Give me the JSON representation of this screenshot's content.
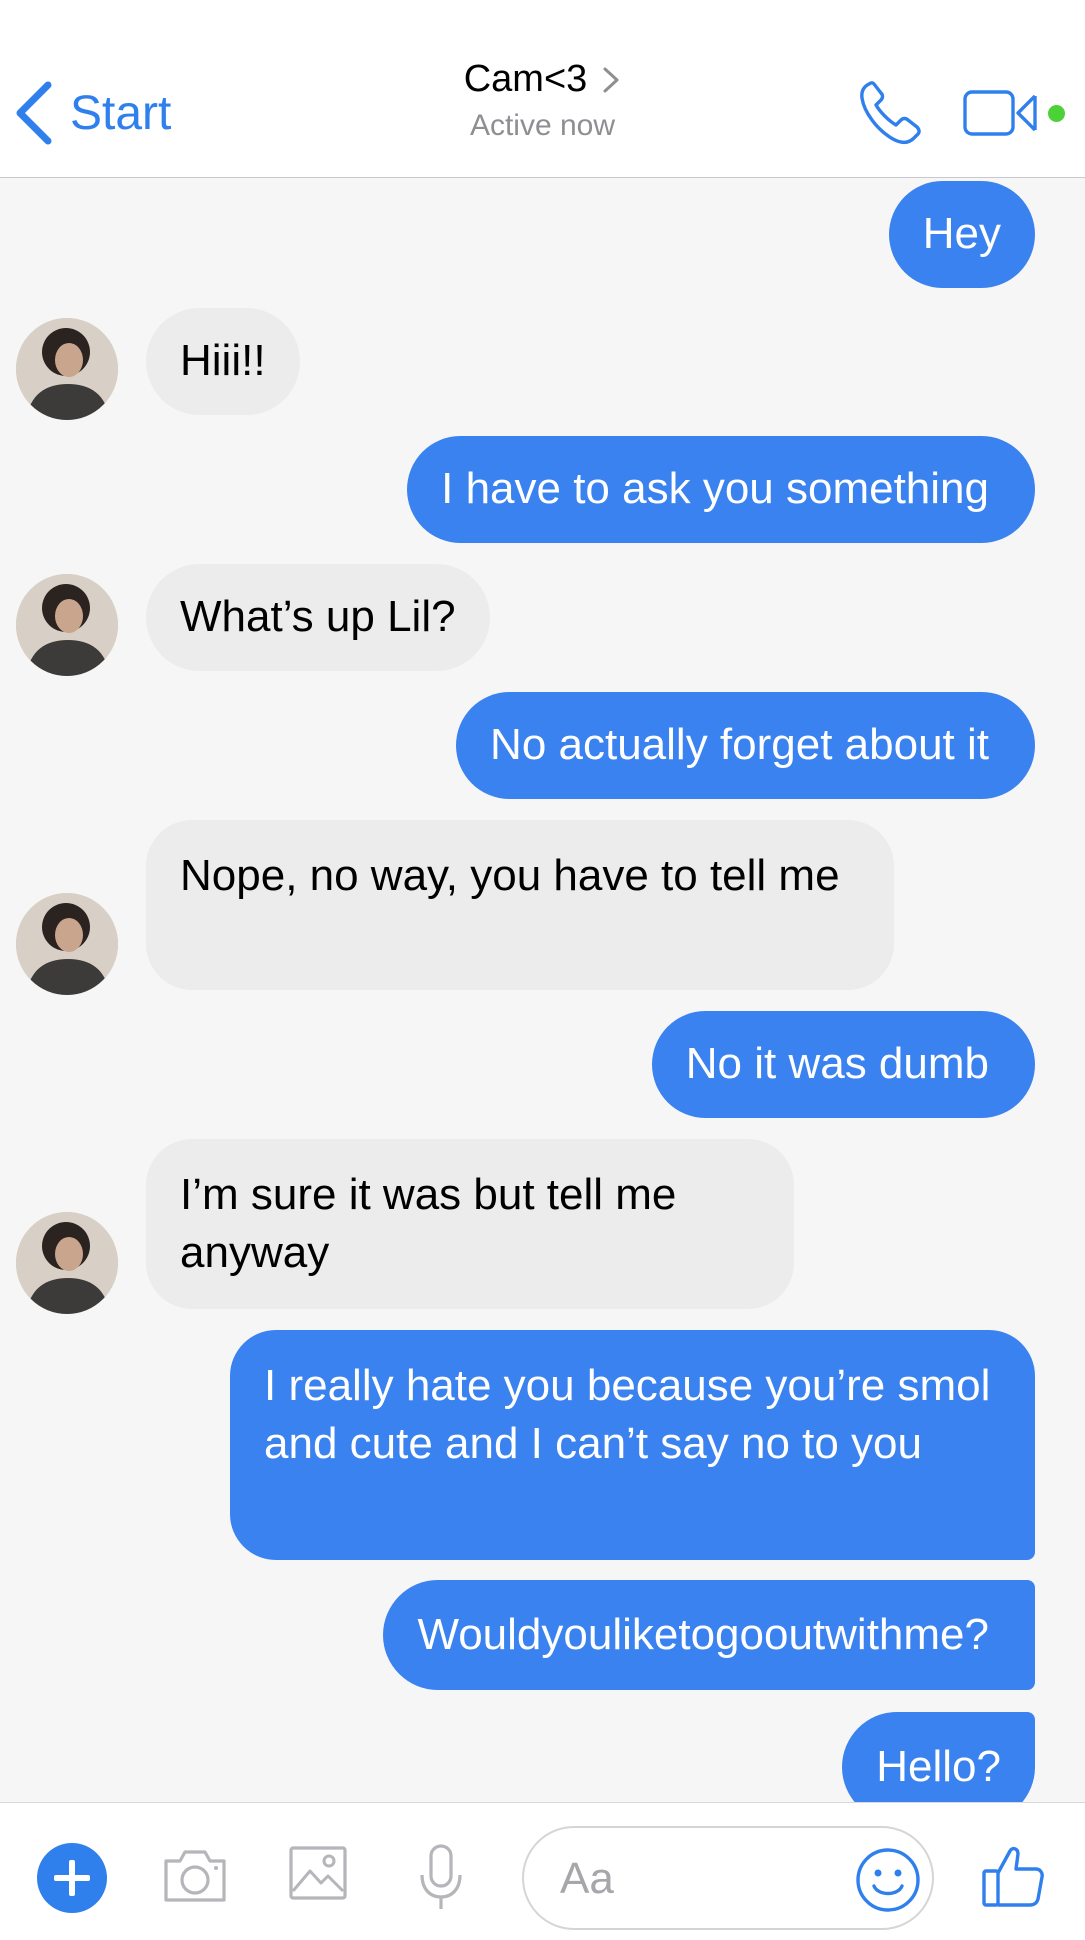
{
  "header": {
    "back_label": "Start",
    "contact_name": "Cam<3",
    "status": "Active now",
    "accent_color": "#2f80ed",
    "online_color": "#4cd137"
  },
  "messages": [
    {
      "dir": "out",
      "text": "Hey"
    },
    {
      "dir": "in",
      "text": "Hiii!!"
    },
    {
      "dir": "out",
      "text": "I have to ask you something"
    },
    {
      "dir": "in",
      "text": "What’s up Lil?"
    },
    {
      "dir": "out",
      "text": "No actually forget about it"
    },
    {
      "dir": "in",
      "text": "Nope, no way, you have to tell me"
    },
    {
      "dir": "out",
      "text": "No it was dumb"
    },
    {
      "dir": "in",
      "text": "I’m sure it was but tell me anyway"
    },
    {
      "dir": "out",
      "text": "I really hate you because you’re smol and cute and I can’t say no to you"
    },
    {
      "dir": "out",
      "text": "Wouldyouliketogooutwithme?"
    },
    {
      "dir": "out",
      "text": "Hello?"
    }
  ],
  "composer": {
    "placeholder": "Aa",
    "icons": [
      "plus-icon",
      "camera-icon",
      "image-icon",
      "microphone-icon",
      "emoji-icon",
      "thumbs-up-icon"
    ]
  },
  "colors": {
    "outgoing_bubble": "#3a82ef",
    "incoming_bubble": "#ececec",
    "chat_background": "#f6f6f6"
  }
}
